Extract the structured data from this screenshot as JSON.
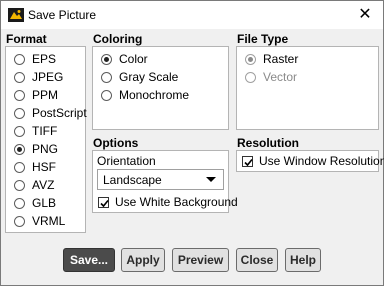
{
  "window": {
    "title": "Save Picture",
    "close_glyph": "✕",
    "icon": "app-icon"
  },
  "format": {
    "title": "Format",
    "options": [
      "EPS",
      "JPEG",
      "PPM",
      "PostScript",
      "TIFF",
      "PNG",
      "HSF",
      "AVZ",
      "GLB",
      "VRML"
    ],
    "selected": "PNG"
  },
  "coloring": {
    "title": "Coloring",
    "options": [
      "Color",
      "Gray Scale",
      "Monochrome"
    ],
    "selected": "Color"
  },
  "file_type": {
    "title": "File Type",
    "options": [
      "Raster",
      "Vector"
    ],
    "selected": "Raster"
  },
  "options": {
    "title": "Options",
    "orientation_label": "Orientation",
    "orientation_value": "Landscape",
    "white_background_label": "Use White Background",
    "white_background_checked": true
  },
  "resolution": {
    "title": "Resolution",
    "window_resolution_label": "Use Window Resolution",
    "window_resolution_checked": true
  },
  "buttons": {
    "save": "Save...",
    "apply": "Apply",
    "preview": "Preview",
    "close": "Close",
    "help": "Help"
  }
}
